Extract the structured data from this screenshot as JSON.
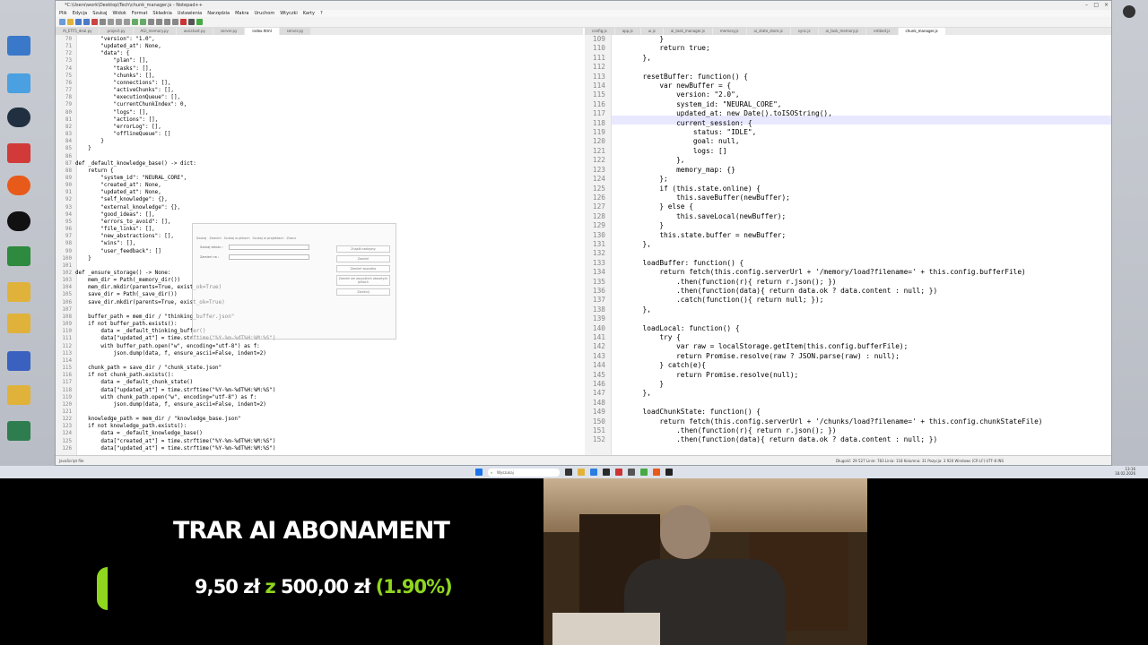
{
  "window": {
    "title": "*C:\\Users\\work\\Desktop\\Tech\\chunk_manager.js - Notepad++",
    "menu": [
      "Plik",
      "Edycja",
      "Szukaj",
      "Widok",
      "Format",
      "Składnia",
      "Ustawienia",
      "Narzędzia",
      "Makra",
      "Uruchom",
      "Wtyczki",
      "Karty",
      "?"
    ],
    "left_tabs": [
      "AI_ETF5_deal.py",
      "project.py",
      "AGI_memory.py",
      "assistant.py",
      "server.py",
      "index.html",
      "server.py"
    ],
    "right_tabs": [
      "config.js",
      "app.js",
      "ui.js",
      "ai_task_manager.js",
      "memory.js",
      "ui_state_store.js",
      "sync.js",
      "ai_task_memory.js",
      "embed.js",
      "chunk_manager.js"
    ]
  },
  "left_pane": {
    "lines": [
      {
        "n": "70",
        "text": "        \"version\": \"1.0\","
      },
      {
        "n": "71",
        "text": "        \"updated_at\": None,"
      },
      {
        "n": "72",
        "text": "        \"data\": {"
      },
      {
        "n": "73",
        "text": "            \"plan\": [],"
      },
      {
        "n": "74",
        "text": "            \"tasks\": [],"
      },
      {
        "n": "75",
        "text": "            \"chunks\": [],"
      },
      {
        "n": "76",
        "text": "            \"connections\": [],"
      },
      {
        "n": "77",
        "text": "            \"activeChunks\": [],"
      },
      {
        "n": "78",
        "text": "            \"executionQueue\": [],"
      },
      {
        "n": "79",
        "text": "            \"currentChunkIndex\": 0,"
      },
      {
        "n": "80",
        "text": "            \"logs\": [],"
      },
      {
        "n": "81",
        "text": "            \"actions\": [],"
      },
      {
        "n": "82",
        "text": "            \"errorLog\": [],"
      },
      {
        "n": "83",
        "text": "            \"offlineQueue\": []"
      },
      {
        "n": "84",
        "text": "        }"
      },
      {
        "n": "85",
        "text": "    }"
      },
      {
        "n": "86",
        "text": ""
      },
      {
        "n": "87",
        "text": "def _default_knowledge_base() -> dict:"
      },
      {
        "n": "88",
        "text": "    return {"
      },
      {
        "n": "89",
        "text": "        \"system_id\": \"NEURAL_CORE\","
      },
      {
        "n": "90",
        "text": "        \"created_at\": None,"
      },
      {
        "n": "91",
        "text": "        \"updated_at\": None,"
      },
      {
        "n": "92",
        "text": "        \"self_knowledge\": {},"
      },
      {
        "n": "93",
        "text": "        \"external_knowledge\": {},"
      },
      {
        "n": "94",
        "text": "        \"good_ideas\": [],"
      },
      {
        "n": "95",
        "text": "        \"errors_to_avoid\": [],"
      },
      {
        "n": "96",
        "text": "        \"file_links\": [],"
      },
      {
        "n": "97",
        "text": "        \"new_abstractions\": [],"
      },
      {
        "n": "98",
        "text": "        \"wins\": [],"
      },
      {
        "n": "99",
        "text": "        \"user_feedback\": []"
      },
      {
        "n": "100",
        "text": "    }"
      },
      {
        "n": "101",
        "text": ""
      },
      {
        "n": "102",
        "text": "def _ensure_storage() -> None:"
      },
      {
        "n": "103",
        "text": "    mem_dir = Path(_memory_dir())"
      },
      {
        "n": "104",
        "text": "    mem_dir.mkdir(parents=True, exist_ok=True)"
      },
      {
        "n": "105",
        "text": "    save_dir = Path(_save_dir())"
      },
      {
        "n": "106",
        "text": "    save_dir.mkdir(parents=True, exist_ok=True)"
      },
      {
        "n": "107",
        "text": ""
      },
      {
        "n": "108",
        "text": "    buffer_path = mem_dir / \"thinking_buffer.json\""
      },
      {
        "n": "109",
        "text": "    if not buffer_path.exists():"
      },
      {
        "n": "110",
        "text": "        data = _default_thinking_buffer()"
      },
      {
        "n": "111",
        "text": "        data[\"updated_at\"] = time.strftime(\"%Y-%m-%dT%H:%M:%S\")"
      },
      {
        "n": "112",
        "text": "        with buffer_path.open(\"w\", encoding=\"utf-8\") as f:"
      },
      {
        "n": "113",
        "text": "            json.dump(data, f, ensure_ascii=False, indent=2)"
      },
      {
        "n": "114",
        "text": ""
      },
      {
        "n": "115",
        "text": "    chunk_path = save_dir / \"chunk_state.json\""
      },
      {
        "n": "116",
        "text": "    if not chunk_path.exists():"
      },
      {
        "n": "117",
        "text": "        data = _default_chunk_state()"
      },
      {
        "n": "118",
        "text": "        data[\"updated_at\"] = time.strftime(\"%Y-%m-%dT%H:%M:%S\")"
      },
      {
        "n": "119",
        "text": "        with chunk_path.open(\"w\", encoding=\"utf-8\") as f:"
      },
      {
        "n": "120",
        "text": "            json.dump(data, f, ensure_ascii=False, indent=2)"
      },
      {
        "n": "121",
        "text": ""
      },
      {
        "n": "122",
        "text": "    knowledge_path = mem_dir / \"knowledge_base.json\""
      },
      {
        "n": "123",
        "text": "    if not knowledge_path.exists():"
      },
      {
        "n": "124",
        "text": "        data = _default_knowledge_base()"
      },
      {
        "n": "125",
        "text": "        data[\"created_at\"] = time.strftime(\"%Y-%m-%dT%H:%M:%S\")"
      },
      {
        "n": "126",
        "text": "        data[\"updated_at\"] = time.strftime(\"%Y-%m-%dT%H:%M:%S\")"
      }
    ]
  },
  "right_pane": {
    "lines": [
      {
        "n": "109",
        "text": "            }"
      },
      {
        "n": "110",
        "text": "            return true;"
      },
      {
        "n": "111",
        "text": "        },"
      },
      {
        "n": "112",
        "text": ""
      },
      {
        "n": "113",
        "text": "        resetBuffer: function() {"
      },
      {
        "n": "114",
        "text": "            var newBuffer = {"
      },
      {
        "n": "115",
        "text": "                version: \"2.0\","
      },
      {
        "n": "116",
        "text": "                system_id: \"NEURAL_CORE\","
      },
      {
        "n": "117",
        "text": "                updated_at: new Date().toISOString(),"
      },
      {
        "n": "118",
        "text": "                current_session: {"
      },
      {
        "n": "119",
        "text": "                    status: \"IDLE\","
      },
      {
        "n": "120",
        "text": "                    goal: null,"
      },
      {
        "n": "121",
        "text": "                    logs: []"
      },
      {
        "n": "122",
        "text": "                },"
      },
      {
        "n": "123",
        "text": "                memory_map: {}"
      },
      {
        "n": "124",
        "text": "            };"
      },
      {
        "n": "125",
        "text": "            if (this.state.online) {"
      },
      {
        "n": "126",
        "text": "                this.saveBuffer(newBuffer);"
      },
      {
        "n": "127",
        "text": "            } else {"
      },
      {
        "n": "128",
        "text": "                this.saveLocal(newBuffer);"
      },
      {
        "n": "129",
        "text": "            }"
      },
      {
        "n": "130",
        "text": "            this.state.buffer = newBuffer;"
      },
      {
        "n": "131",
        "text": "        },"
      },
      {
        "n": "132",
        "text": ""
      },
      {
        "n": "133",
        "text": "        loadBuffer: function() {"
      },
      {
        "n": "134",
        "text": "            return fetch(this.config.serverUrl + '/memory/load?filename=' + this.config.bufferFile)"
      },
      {
        "n": "135",
        "text": "                .then(function(r){ return r.json(); })"
      },
      {
        "n": "136",
        "text": "                .then(function(data){ return data.ok ? data.content : null; })"
      },
      {
        "n": "137",
        "text": "                .catch(function(){ return null; });"
      },
      {
        "n": "138",
        "text": "        },"
      },
      {
        "n": "139",
        "text": ""
      },
      {
        "n": "140",
        "text": "        loadLocal: function() {"
      },
      {
        "n": "141",
        "text": "            try {"
      },
      {
        "n": "142",
        "text": "                var raw = localStorage.getItem(this.config.bufferFile);"
      },
      {
        "n": "143",
        "text": "                return Promise.resolve(raw ? JSON.parse(raw) : null);"
      },
      {
        "n": "144",
        "text": "            } catch(e){"
      },
      {
        "n": "145",
        "text": "                return Promise.resolve(null);"
      },
      {
        "n": "146",
        "text": "            }"
      },
      {
        "n": "147",
        "text": "        },"
      },
      {
        "n": "148",
        "text": ""
      },
      {
        "n": "149",
        "text": "        loadChunkState: function() {"
      },
      {
        "n": "150",
        "text": "            return fetch(this.config.serverUrl + '/chunks/load?filename=' + this.config.chunkStateFile)"
      },
      {
        "n": "151",
        "text": "                .then(function(r){ return r.json(); })"
      },
      {
        "n": "152",
        "text": "                .then(function(data){ return data.ok ? data.content : null; })"
      }
    ]
  },
  "statusbar": {
    "left": "JavaScript file",
    "right": "Długość: 29 527    Linie: 783    Linia: 118    Kolumna: 31    Pozycja: 3 920    Windows (CR LF)    UTF-8    INS"
  },
  "dialog": {
    "tabs": [
      "Szukaj",
      "Zamień",
      "Szukaj w plikach",
      "Szukaj w projektach",
      "Znacz"
    ],
    "find_label": "Szukaj tekstu :",
    "replace_label": "Zamień na :",
    "buttons": [
      "Znajdź następny",
      "Zamień",
      "Zamień wszystko",
      "Zamień we wszystkich otwartych plikach",
      "Zamknij"
    ]
  },
  "taskbar": {
    "search_placeholder": "Wyszukaj",
    "time": "13:16",
    "date": "18.02.2026"
  },
  "overlay": {
    "title": "TRAR AI ABONAMENT",
    "current": "9,50 zł",
    "connector": "z",
    "goal": "500,00 zł",
    "percent": "(1.90%)",
    "progress": 0.019,
    "accent": "#8fd61f"
  }
}
